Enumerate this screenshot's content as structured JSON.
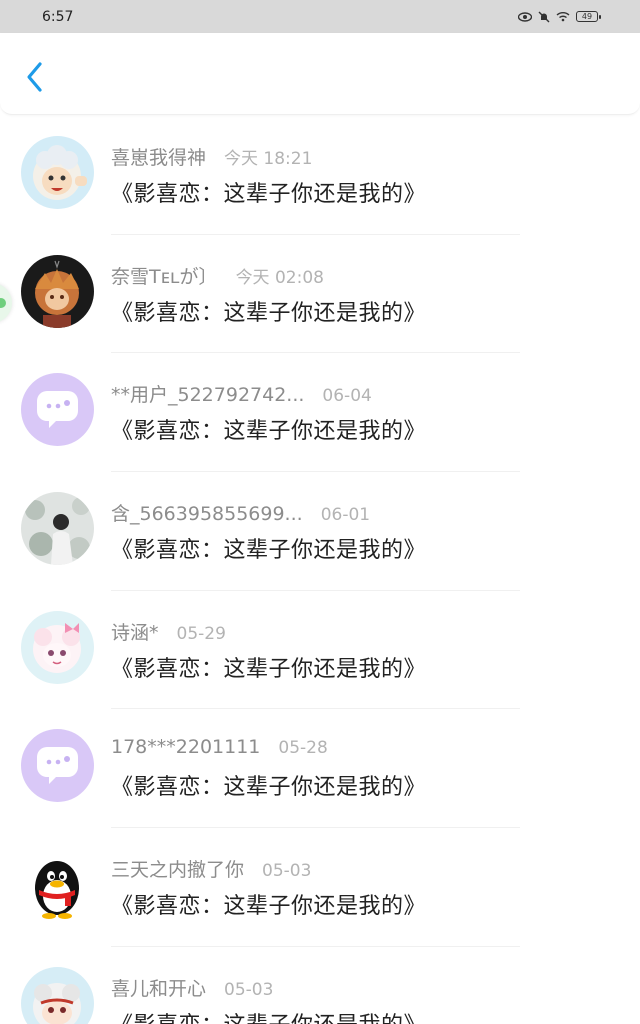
{
  "status_bar": {
    "time": "6:57",
    "battery": "49"
  },
  "comments": [
    {
      "name": "喜崽我得神",
      "time": "今天 18:21",
      "text": "《影喜恋：这辈子你还是我的》",
      "avatar": "goat-cartoon-avatar"
    },
    {
      "name": "奈雪Tᴇʟが〕",
      "time": "今天 02:08",
      "text": "《影喜恋：这辈子你还是我的》",
      "avatar": "anime-character-avatar"
    },
    {
      "name": "**用户_522792742...",
      "time": "06-04",
      "text": "《影喜恋：这辈子你还是我的》",
      "avatar": "default-chat-avatar"
    },
    {
      "name": "含_566395855699...",
      "time": "06-01",
      "text": "《影喜恋：这辈子你还是我的》",
      "avatar": "photo-avatar"
    },
    {
      "name": "诗涵*",
      "time": "05-29",
      "text": "《影喜恋：这辈子你还是我的》",
      "avatar": "pink-goat-avatar"
    },
    {
      "name": "178***2201111",
      "time": "05-28",
      "text": "《影喜恋：这辈子你还是我的》",
      "avatar": "default-chat-avatar"
    },
    {
      "name": "三天之内撤了你",
      "time": "05-03",
      "text": "《影喜恋：这辈子你还是我的》",
      "avatar": "penguin-avatar"
    },
    {
      "name": "喜儿和开心",
      "time": "05-03",
      "text": "《影喜恋：这辈子你还是我的》",
      "avatar": "goat-red-avatar"
    }
  ],
  "colors": {
    "accent": "#1e9be8",
    "default_avatar_bg": "#d9c8f7"
  }
}
